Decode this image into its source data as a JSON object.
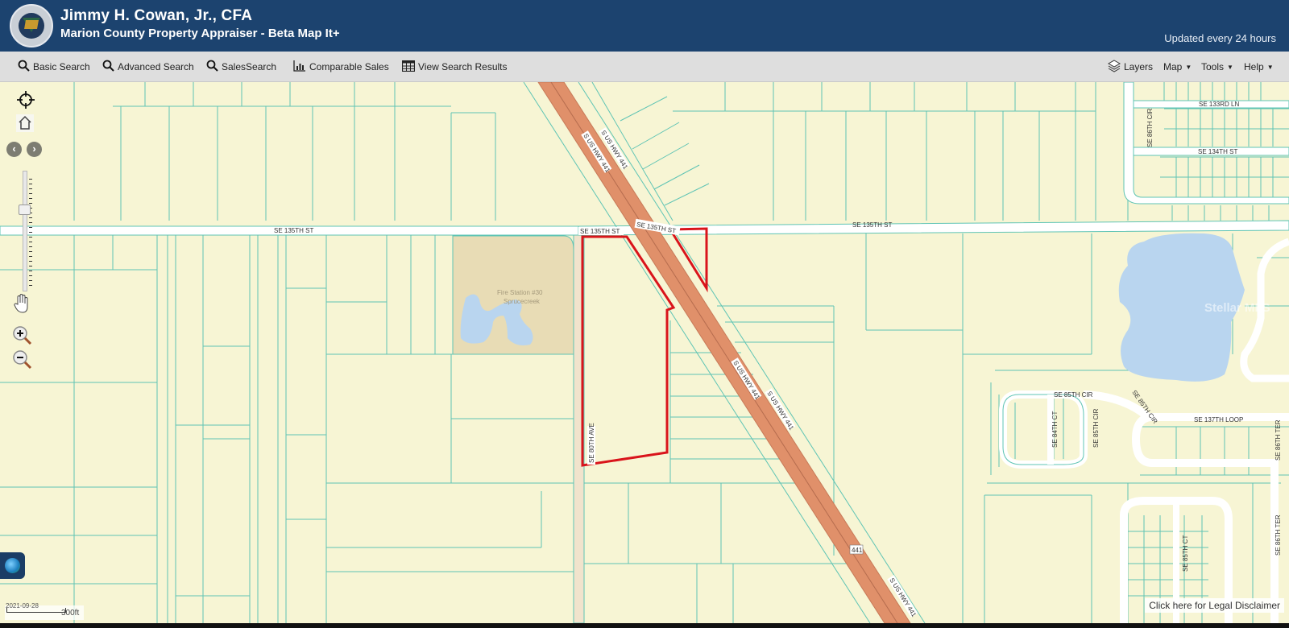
{
  "header": {
    "title": "Jimmy H. Cowan, Jr., CFA",
    "subtitle": "Marion County Property Appraiser - Beta Map It+",
    "updated": "Updated every 24 hours",
    "logo": "property-appraiser-seal"
  },
  "toolbar": {
    "left": [
      {
        "label": "Basic Search",
        "icon": "search-icon"
      },
      {
        "label": "Advanced Search",
        "icon": "search-icon"
      },
      {
        "label": "SalesSearch",
        "icon": "search-icon"
      },
      {
        "label": "Comparable Sales",
        "icon": "bar-chart-icon"
      },
      {
        "label": "View Search Results",
        "icon": "table-icon"
      }
    ],
    "right": [
      {
        "label": "Layers",
        "icon": "layers-icon"
      },
      {
        "label": "Map",
        "dropdown": true
      },
      {
        "label": "Tools",
        "dropdown": true
      },
      {
        "label": "Help",
        "dropdown": true
      }
    ]
  },
  "map_controls": {
    "locate": "crosshair-icon",
    "home": "home-icon",
    "back": "‹",
    "forward": "›",
    "zoom_level_fraction": 0.3,
    "pan": "hand-icon",
    "zoom_in": "+",
    "zoom_out": "−"
  },
  "map": {
    "street_labels": {
      "se135_west": "SE 135TH ST",
      "se135_mid1": "SE 135TH ST",
      "se135_mid2": "SE 135TH ST",
      "se135_east": "SE 135TH ST",
      "hwy1": "S US HWY 441",
      "hwy2": "S US HWY 441",
      "hwy3": "S US HWY 441",
      "hwy4": "S US HWY 441",
      "hwy5": "S US HWY 441",
      "shield": "441",
      "se80ave": "SE 80TH AVE",
      "se133ln": "SE 133RD LN",
      "se134st": "SE 134TH ST",
      "se85cir_n": "SE 85TH CIR",
      "se85cir_v": "SE 85TH CIR",
      "se85cir_diag": "SE 85TH CIR",
      "se84ct": "SE 84TH CT",
      "se137loop": "SE 137TH LOOP",
      "se86ter1": "SE 86TH TER",
      "se86ter2": "SE 86TH TER",
      "se85ct": "SE 85TH CT",
      "se86cir": "SE 86TH CIR"
    },
    "poi": {
      "name": "Fire Station #30",
      "sub": "Sprucecreek"
    },
    "selected_parcel_color": "#d9141b",
    "parcel_line_color": "#5fc4b4",
    "land_color": "#f7f5d4",
    "highway_color": "#e0906a",
    "water_color": "#b9d5ef",
    "watermark": "Stellar MLS"
  },
  "scale": {
    "label": "300ft"
  },
  "date_stamp": "2021-09-28",
  "disclaimer": "Click here for Legal Disclaimer"
}
